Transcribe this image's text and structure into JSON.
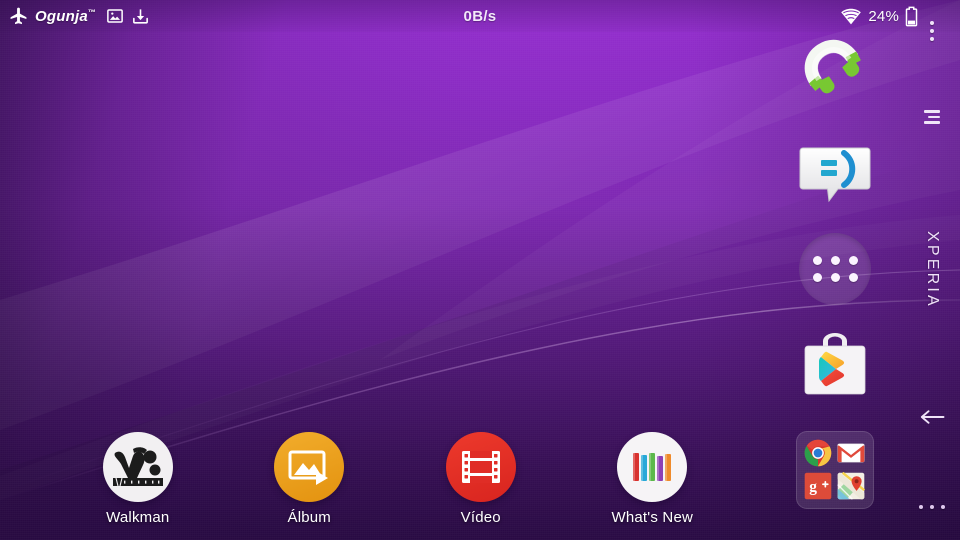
{
  "device": {
    "brand_word": "XPERIA"
  },
  "statusbar": {
    "carrier": "Ogunja",
    "carrier_tm": "™",
    "airplane_icon": "airplane-mode-icon",
    "screenshot_icon": "screenshot-icon",
    "download_icon": "download-icon",
    "network_speed": "0B/s",
    "wifi_icon": "wifi-icon",
    "battery_percent": "24%",
    "battery_icon": "battery-icon"
  },
  "navbar": {
    "overflow_icon": "overflow-menu-icon",
    "recents_icon": "recent-apps-icon",
    "back_icon": "back-arrow-icon",
    "more_icon": "more-options-icon"
  },
  "side_apps": [
    {
      "name": "Phone",
      "icon": "phone-icon"
    },
    {
      "name": "Messaging",
      "icon": "messaging-icon"
    },
    {
      "name": "App drawer",
      "icon": "app-drawer-icon"
    },
    {
      "name": "Play Store",
      "icon": "play-store-icon"
    }
  ],
  "google_folder": {
    "name": "Google",
    "apps": [
      {
        "name": "Chrome",
        "icon": "chrome-icon"
      },
      {
        "name": "Gmail",
        "icon": "gmail-icon"
      },
      {
        "name": "Google+",
        "icon": "google-plus-icon"
      },
      {
        "name": "Maps",
        "icon": "maps-icon"
      }
    ]
  },
  "dock": {
    "items": [
      {
        "label": "Walkman",
        "icon": "walkman-icon",
        "color": "#f2f0f2"
      },
      {
        "label": "Álbum",
        "icon": "album-icon",
        "color": "#eda01f"
      },
      {
        "label": "Vídeo",
        "icon": "video-icon",
        "color": "#e02d26"
      },
      {
        "label": "What's New",
        "icon": "whats-new-icon",
        "color": "#f4f2f4"
      }
    ]
  },
  "theme": {
    "wallpaper_top": "#9b31d6",
    "wallpaper_bottom": "#3c1160",
    "accent": "#8b2bc4",
    "text_on_wallpaper": "#ffffff"
  }
}
